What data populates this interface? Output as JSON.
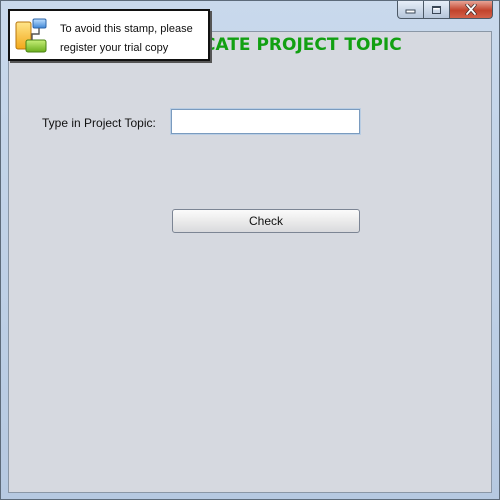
{
  "window": {
    "controls": {
      "minimize_icon": "minimize-icon",
      "maximize_icon": "maximize-icon",
      "close_icon": "close-icon"
    }
  },
  "heading": {
    "text": "CATE PROJECT TOPIC",
    "color": "#12a012"
  },
  "form": {
    "topic_label": "Type in Project Topic:",
    "topic_value": "",
    "topic_placeholder": "",
    "check_button_label": "Check"
  },
  "stamp": {
    "line1": "To avoid this stamp, please",
    "line2": "register your trial copy",
    "icon": "stamp-logo-icon"
  }
}
